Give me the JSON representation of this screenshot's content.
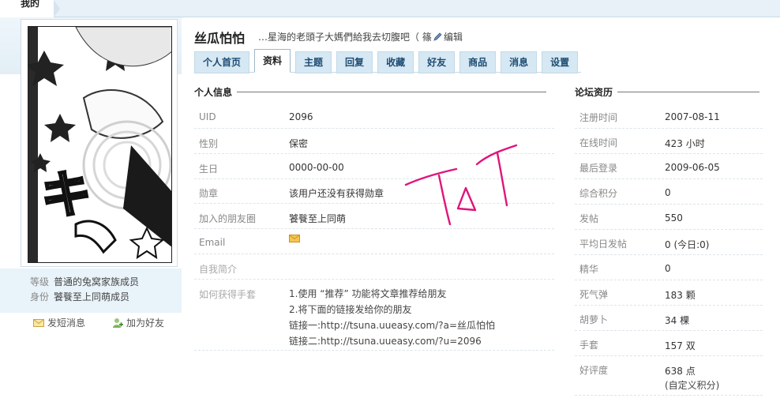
{
  "breadcrumb": {
    "current": "我的"
  },
  "profile": {
    "username": "丝瓜怕怕",
    "signature": "…星海的老頭子大媽們給我去切腹吧（ 篠",
    "edit_label": "编辑",
    "level_key": "等级",
    "level_value": "普通的兔窝家族成员",
    "rank_key": "身份",
    "rank_value": "饕餮至上同萌成员",
    "send_message": "发短消息",
    "add_friend": "加为好友",
    "avatar_label": "キ"
  },
  "tabs": [
    {
      "label": "个人首页"
    },
    {
      "label": "资料"
    },
    {
      "label": "主题"
    },
    {
      "label": "回复"
    },
    {
      "label": "收藏"
    },
    {
      "label": "好友"
    },
    {
      "label": "商品"
    },
    {
      "label": "消息"
    },
    {
      "label": "设置"
    }
  ],
  "personal_info": {
    "title": "个人信息",
    "rows": [
      {
        "label": "UID",
        "value": "2096"
      },
      {
        "label": "性别",
        "value": "保密"
      },
      {
        "label": "生日",
        "value": "0000-00-00"
      },
      {
        "label": "勋章",
        "value": "该用户还没有获得勋章"
      },
      {
        "label": "加入的朋友圈",
        "value": "饕餮至上同萌"
      },
      {
        "label": "Email",
        "value": ""
      },
      {
        "label": "自我简介",
        "value": ""
      },
      {
        "label": "如何获得手套",
        "value": ""
      }
    ],
    "recommend_lines": [
      "1.使用 “推荐” 功能将文章推荐给朋友",
      "2.将下面的链接发给你的朋友",
      "链接一:http://tsuna.uueasy.com/?a=丝瓜怕怕",
      "链接二:http://tsuna.uueasy.com/?u=2096"
    ]
  },
  "forum_history": {
    "title": "论坛资历",
    "rows": [
      {
        "label": "注册时间",
        "value": "2007-08-11"
      },
      {
        "label": "在线时间",
        "value": "423 小时"
      },
      {
        "label": "最后登录",
        "value": "2009-06-05"
      },
      {
        "label": "综合积分",
        "value": "0"
      },
      {
        "label": "发帖",
        "value": "550"
      },
      {
        "label": "平均日发帖",
        "value": "0 (今日:0)"
      },
      {
        "label": "精华",
        "value": "0"
      },
      {
        "label": "死气弹",
        "value": "183 颗"
      },
      {
        "label": "胡萝卜",
        "value": "34 棵"
      },
      {
        "label": "手套",
        "value": "157 双"
      },
      {
        "label": "好评度",
        "value": "638 点"
      }
    ],
    "footnote": "(自定义积分)"
  },
  "scribble_text": "T o T",
  "colors": {
    "accent": "#1f4b72",
    "tab_bg": "#d5e8f3",
    "scribble": "#e0157a"
  }
}
